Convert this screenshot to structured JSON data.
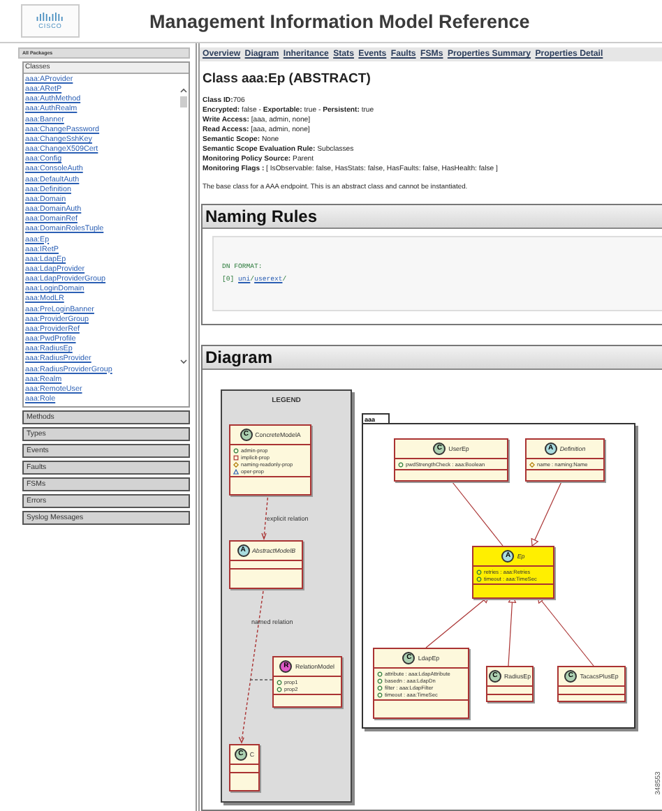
{
  "header": {
    "logo": "CISCO",
    "title": "Management Information Model Reference"
  },
  "sidebar": {
    "packages_label": "All Packages",
    "classes_header": "Classes",
    "classes": [
      "aaa:AProvider",
      "aaa:ARetP",
      "aaa:AuthMethod",
      "aaa:AuthRealm",
      "aaa:Banner",
      "aaa:ChangePassword",
      "aaa:ChangeSshKey",
      "aaa:ChangeX509Cert",
      "aaa:Config",
      "aaa:ConsoleAuth",
      "aaa:DefaultAuth",
      "aaa:Definition",
      "aaa:Domain",
      "aaa:DomainAuth",
      "aaa:DomainRef",
      "aaa:DomainRolesTuple",
      "aaa:Ep",
      "aaa:IRetP",
      "aaa:LdapEp",
      "aaa:LdapProvider",
      "aaa:LdapProviderGroup",
      "aaa:LoginDomain",
      "aaa:ModLR",
      "aaa:PreLoginBanner",
      "aaa:ProviderGroup",
      "aaa:ProviderRef",
      "aaa:PwdProfile",
      "aaa:RadiusEp",
      "aaa:RadiusProvider",
      "aaa:RadiusProviderGroup",
      "aaa:Realm",
      "aaa:RemoteUser",
      "aaa:Role"
    ],
    "sections": [
      "Methods",
      "Types",
      "Events",
      "Faults",
      "FSMs",
      "Errors",
      "Syslog Messages"
    ]
  },
  "nav": [
    "Overview",
    "Diagram",
    "Inheritance",
    "Stats",
    "Events",
    "Faults",
    "FSMs",
    "Properties Summary",
    "Properties Detail"
  ],
  "class_title": "Class aaa:Ep (ABSTRACT)",
  "details": [
    "**Class ID:**706",
    "**Encrypted:** false - **Exportable:** true - **Persistent:** true",
    "**Write Access:** [aaa, admin, none]",
    "**Read Access:** [aaa, admin, none]",
    "**Semantic Scope:** None",
    "**Semantic Scope Evaluation Rule:** Subclasses",
    "**Monitoring Policy Source:** Parent",
    "**Monitoring Flags :** [ IsObservable: false, HasStats: false, HasFaults: false, HasHealth: false ]"
  ],
  "description": "The base class for a AAA endpoint. This is an abstract class and cannot be instantiated.",
  "naming_rules": {
    "title": "Naming Rules",
    "format_label": "DN FORMAT:",
    "rules": [
      {
        "index": "[0]",
        "segments": [
          {
            "text": "uni",
            "link": true
          },
          {
            "text": "/",
            "link": false
          },
          {
            "text": "userext",
            "link": true
          },
          {
            "text": "/",
            "link": false
          }
        ]
      }
    ]
  },
  "diagram": {
    "title": "Diagram",
    "legend": {
      "title": "LEGEND",
      "nodes": [
        {
          "kind": "concrete",
          "badge": "C",
          "name": "ConcreteModelA",
          "props": [
            {
              "kind": "admin",
              "text": "admin-prop"
            },
            {
              "kind": "implicit",
              "text": "implicit-prop"
            },
            {
              "kind": "naming",
              "text": "naming-readonly-prop"
            },
            {
              "kind": "oper",
              "text": "oper-prop"
            }
          ]
        },
        {
          "kind": "abstract",
          "badge": "A",
          "name": "AbstractModelB"
        },
        {
          "kind": "relation",
          "badge": "R",
          "name": "RelationModel",
          "props": [
            {
              "kind": "admin",
              "text": "prop1"
            },
            {
              "kind": "admin",
              "text": "prop2"
            }
          ]
        },
        {
          "kind": "concrete",
          "badge": "C",
          "name": "C"
        }
      ],
      "relations": [
        {
          "label": "explicit relation"
        },
        {
          "label": "named relation"
        }
      ]
    },
    "package": {
      "name": "aaa",
      "nodes": [
        {
          "kind": "concrete",
          "badge": "C",
          "name": "UserEp",
          "highlighted": false,
          "props": [
            {
              "kind": "admin",
              "text": "pwdStrengthCheck : aaa:Boolean"
            }
          ]
        },
        {
          "kind": "abstract",
          "badge": "A",
          "name": "Definition",
          "highlighted": false,
          "props": [
            {
              "kind": "naming",
              "text": "name : naming:Name"
            }
          ]
        },
        {
          "kind": "abstract",
          "badge": "A",
          "name": "Ep",
          "highlighted": true,
          "props": [
            {
              "kind": "admin",
              "text": "retries : aaa:Retries"
            },
            {
              "kind": "admin",
              "text": "timeout : aaa:TimeSec"
            }
          ]
        },
        {
          "kind": "concrete",
          "badge": "C",
          "name": "LdapEp",
          "highlighted": false,
          "props": [
            {
              "kind": "admin",
              "text": "attribute : aaa:LdapAttribute"
            },
            {
              "kind": "admin",
              "text": "basedn : aaa:LdapDn"
            },
            {
              "kind": "admin",
              "text": "filter : aaa:LdapFilter"
            },
            {
              "kind": "admin",
              "text": "timeout : aaa:TimeSec"
            }
          ]
        },
        {
          "kind": "concrete",
          "badge": "C",
          "name": "RadiusEp",
          "highlighted": false
        },
        {
          "kind": "concrete",
          "badge": "C",
          "name": "TacacsPlusEp",
          "highlighted": false
        }
      ],
      "relations": [
        {
          "kind": "composition"
        },
        {
          "kind": "generalization"
        },
        {
          "kind": "generalization"
        },
        {
          "kind": "generalization"
        },
        {
          "kind": "generalization"
        }
      ]
    }
  },
  "figure_number": "348553"
}
